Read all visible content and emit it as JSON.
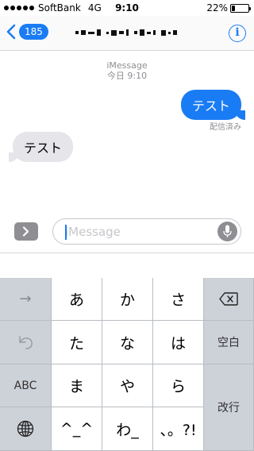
{
  "status_bar": {
    "carrier": "SoftBank",
    "network": "4G",
    "time": "9:10",
    "battery": "22%",
    "battery_level": 0.22
  },
  "nav": {
    "back_badge": "185",
    "info_glyph": "i"
  },
  "conversation": {
    "service": "iMessage",
    "timestamp": "今日 9:10",
    "messages": [
      {
        "direction": "outgoing",
        "text": "テスト"
      },
      {
        "direction": "incoming",
        "text": "テスト"
      }
    ],
    "delivered_label": "配信済み"
  },
  "composer": {
    "placeholder": "iMessage",
    "value": ""
  },
  "keyboard": {
    "keys": {
      "arrow": "→",
      "a": "あ",
      "ka": "か",
      "sa": "さ",
      "ta": "た",
      "na": "な",
      "ha": "は",
      "space": "空白",
      "abc": "ABC",
      "ma": "ま",
      "ya": "や",
      "ra": "ら",
      "return": "改行",
      "emoticon": "^_^",
      "wa": "わ_",
      "punct": "、。?!"
    },
    "icons": {
      "delete": "delete-icon",
      "undo": "undo-icon",
      "globe": "globe-icon"
    }
  },
  "colors": {
    "accent": "#1a7cf5",
    "incoming_bubble": "#e5e5ea",
    "meta_text": "#8e8e93"
  }
}
